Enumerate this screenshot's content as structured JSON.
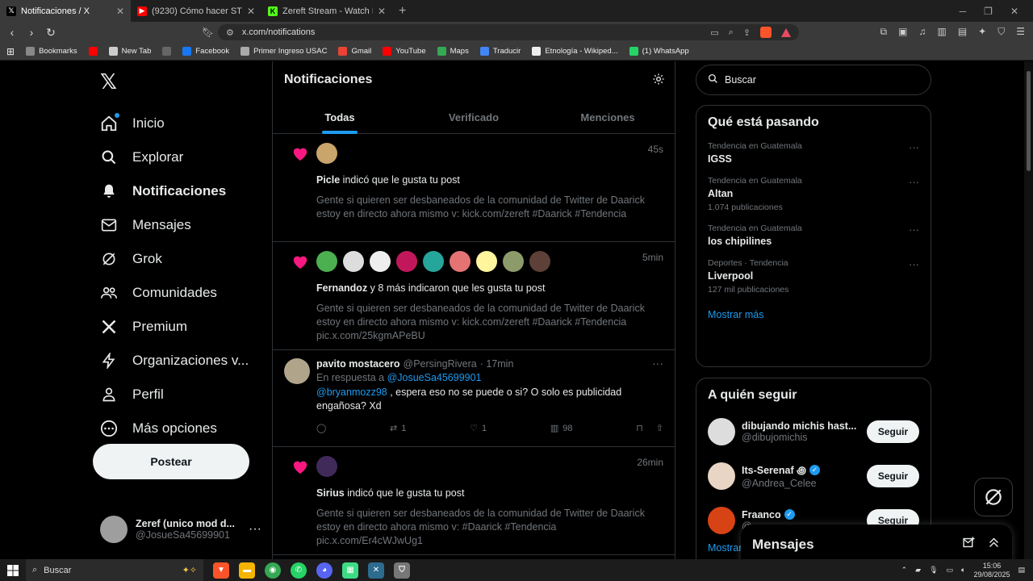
{
  "browser": {
    "tabs": [
      {
        "title": "Notificaciones / X",
        "icon": "X",
        "color": "#000000",
        "active": true
      },
      {
        "title": "(9230) Cómo hacer STREAM en KICK",
        "icon": "▶",
        "color": "#ff0000",
        "active": false
      },
      {
        "title": "Zereft Stream - Watch Live on Kick",
        "icon": "K",
        "color": "#53fc18",
        "active": false
      }
    ],
    "url": "x.com/notifications",
    "bookmarks": [
      {
        "label": "Bookmarks",
        "color": "#888888"
      },
      {
        "label": "",
        "color": "#ff0000"
      },
      {
        "label": "New Tab",
        "color": "#cccccc"
      },
      {
        "label": "",
        "color": "#666666"
      },
      {
        "label": "Facebook",
        "color": "#1877f2"
      },
      {
        "label": "Primer Ingreso USAC",
        "color": "#aaaaaa"
      },
      {
        "label": "Gmail",
        "color": "#ea4335"
      },
      {
        "label": "YouTube",
        "color": "#ff0000"
      },
      {
        "label": "Maps",
        "color": "#34a853"
      },
      {
        "label": "Traducir",
        "color": "#4285f4"
      },
      {
        "label": "Etnología - Wikiped...",
        "color": "#eeeeee"
      },
      {
        "label": "(1) WhatsApp",
        "color": "#25d366"
      }
    ]
  },
  "nav": {
    "items": [
      {
        "label": "Inicio",
        "icon": "home-icon",
        "bold": false,
        "dot": true
      },
      {
        "label": "Explorar",
        "icon": "search-icon",
        "bold": false,
        "dot": false
      },
      {
        "label": "Notificaciones",
        "icon": "bell-icon",
        "bold": true,
        "dot": false
      },
      {
        "label": "Mensajes",
        "icon": "mail-icon",
        "bold": false,
        "dot": false
      },
      {
        "label": "Grok",
        "icon": "grok-icon",
        "bold": false,
        "dot": false
      },
      {
        "label": "Comunidades",
        "icon": "people-icon",
        "bold": false,
        "dot": false
      },
      {
        "label": "Premium",
        "icon": "x-icon",
        "bold": false,
        "dot": false
      },
      {
        "label": "Organizaciones v...",
        "icon": "lightning-icon",
        "bold": false,
        "dot": false
      },
      {
        "label": "Perfil",
        "icon": "person-icon",
        "bold": false,
        "dot": false
      },
      {
        "label": "Más opciones",
        "icon": "more-circle-icon",
        "bold": false,
        "dot": false
      }
    ],
    "post_label": "Postear",
    "account": {
      "name": "Zeref (unico mod d...",
      "handle": "@JosueSa45699901"
    }
  },
  "main": {
    "title": "Notificaciones",
    "tabs": [
      {
        "label": "Todas",
        "active": true
      },
      {
        "label": "Verificado",
        "active": false
      },
      {
        "label": "Menciones",
        "active": false
      }
    ],
    "n1": {
      "time": "45s",
      "actor": "Picle",
      "action": " indicó que le gusta tu post",
      "body": "Gente si quieren ser desbaneados de la comunidad de Twitter de Daarick estoy en directo ahora mismo v: kick.com/zereft #Daarick #Tendencia",
      "avatars": [
        "#c9a46b"
      ]
    },
    "n2": {
      "time": "5min",
      "actor": "Fernandoz",
      "action": " y 8 más indicaron que les gusta tu post",
      "body": "Gente si quieren ser desbaneados de la comunidad de Twitter de Daarick estoy en directo ahora mismo v: kick.com/zereft #Daarick #Tendencia pic.x.com/25kgmAPeBU",
      "avatars": [
        "#4caf50",
        "#dddddd",
        "#eeeeee",
        "#c2185b",
        "#26a69a",
        "#e57373",
        "#fff59d",
        "#8d9b6b",
        "#5d4037"
      ]
    },
    "reply": {
      "name": "pavito mostacero",
      "handle": "@PersingRivera",
      "time": "· 17min",
      "in_reply_prefix": "En respuesta a ",
      "in_reply_to": "@JosueSa45699901",
      "mention": "@bryanmozz98",
      "text": " , espera eso no se puede o si? O solo es publicidad engañosa? Xd",
      "retweets": "1",
      "likes": "1",
      "views": "98"
    },
    "n3": {
      "time": "26min",
      "actor": "Sirius",
      "action": " indicó que le gusta tu post",
      "body": "Gente si quieren ser desbaneados de la comunidad de Twitter de Daarick estoy en directo ahora mismo v: #Daarick #Tendencia pic.x.com/Er4cWJwUg1",
      "avatars": [
        "#3f2a5a"
      ]
    }
  },
  "right": {
    "search_placeholder": "Buscar",
    "trends_title": "Qué está pasando",
    "trends": [
      {
        "context": "Tendencia en Guatemala",
        "name": "IGSS",
        "count": ""
      },
      {
        "context": "Tendencia en Guatemala",
        "name": "Altan",
        "count": "1.074 publicaciones"
      },
      {
        "context": "Tendencia en Guatemala",
        "name": "los chipilines",
        "count": ""
      },
      {
        "context": "Deportes · Tendencia",
        "name": "Liverpool",
        "count": "127 mil publicaciones"
      }
    ],
    "show_more": "Mostrar más",
    "follow_title": "A quién seguir",
    "follow": [
      {
        "name": "dibujando michis hast...",
        "handle": "@dibujomichis",
        "verified": false,
        "color": "#dddddd"
      },
      {
        "name": "Its-Serenaf ꩜",
        "handle": "@Andrea_Celee",
        "verified": true,
        "color": "#e8d5c4"
      },
      {
        "name": "Fraanco",
        "handle": "@",
        "verified": true,
        "color": "#d84315"
      }
    ],
    "follow_label": "Seguir",
    "show_more_partial": "Mostrar"
  },
  "messages": {
    "title": "Mensajes"
  },
  "taskbar": {
    "search": "Buscar",
    "time": "15:06",
    "date": "29/08/2025"
  }
}
